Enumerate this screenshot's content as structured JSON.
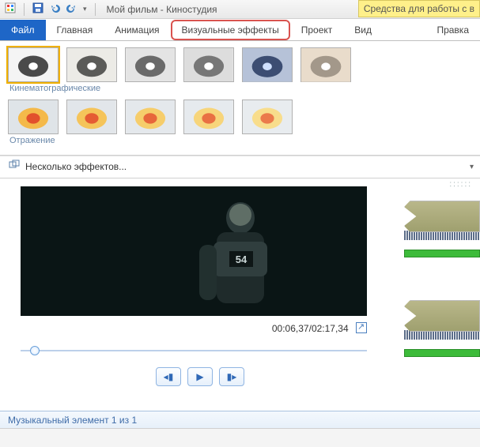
{
  "title": "Мой фильм - Киностудия",
  "context_tab": "Средства для работы с в",
  "tabs": {
    "file": "Файл",
    "home": "Главная",
    "anim": "Анимация",
    "vfx": "Визуальные эффекты",
    "project": "Проект",
    "view": "Вид",
    "edit": "Правка"
  },
  "groups": {
    "cinema": "Кинематографические",
    "mirror": "Отражение"
  },
  "multi_effects": "Несколько эффектов...",
  "time": {
    "current": "00:06,37",
    "total": "02:17,34"
  },
  "status": "Музыкальный элемент 1 из 1",
  "jersey_number": "54"
}
